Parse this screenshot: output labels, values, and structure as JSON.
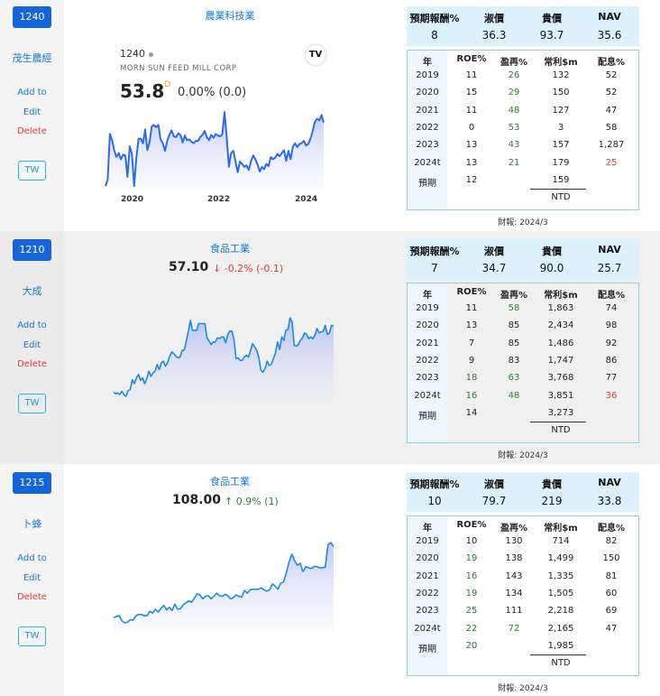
{
  "stocks": [
    {
      "code": "1240",
      "name": "茂生農經",
      "sector": "農業科技業",
      "tv": {
        "symbol": "1240",
        "company": "MORN SUN FEED MILL CORP",
        "price": "53.8",
        "flag": "D",
        "change": "0.00% (0.0)",
        "logo": "TV",
        "years": [
          "2020",
          "2022",
          "2024"
        ]
      },
      "actions": {
        "add": "Add to",
        "edit": "Edit",
        "delete": "Delete",
        "tw": "TW"
      },
      "header": {
        "labels": [
          "預期報酬%",
          "淑價",
          "貴價",
          "NAV"
        ],
        "values": [
          "8",
          "36.3",
          "93.7",
          "35.6"
        ]
      },
      "cols": [
        "年",
        "ROE%",
        "盈再%",
        "常利$m",
        "配息%"
      ],
      "rows": [
        [
          "2019",
          "11",
          "26",
          "132",
          "52"
        ],
        [
          "2020",
          "15",
          "29",
          "150",
          "52"
        ],
        [
          "2021",
          "11",
          "48",
          "127",
          "47"
        ],
        [
          "2022",
          "0",
          "53",
          "3",
          "58"
        ],
        [
          "2023",
          "13",
          "43",
          "157",
          "1,287"
        ],
        [
          "2024t",
          "13",
          "21",
          "179",
          "25"
        ],
        [
          "預期",
          "12",
          "",
          "159",
          ""
        ]
      ],
      "currency": "NTD",
      "report": "財報: 2024/3",
      "series": [
        20,
        28,
        88,
        80,
        66,
        58,
        63,
        55,
        61,
        60,
        32,
        72,
        62,
        20,
        57,
        82,
        82,
        76,
        94,
        67,
        78,
        98,
        100,
        97,
        100,
        81,
        76,
        66,
        79,
        87,
        93,
        85,
        84,
        89,
        87,
        77,
        86,
        80,
        81,
        78,
        76,
        79,
        79,
        84,
        87,
        92,
        84,
        80,
        87,
        83,
        88,
        86,
        85,
        88,
        117,
        84,
        45,
        63,
        66,
        52,
        38,
        52,
        49,
        45,
        47,
        41,
        52,
        60,
        55,
        48,
        39,
        45,
        42,
        49,
        46,
        58,
        55,
        57,
        62,
        59,
        63,
        67,
        53,
        66,
        55,
        71,
        76,
        71,
        75,
        76,
        79,
        73,
        75,
        82,
        92,
        104,
        108,
        106,
        113,
        103
      ]
    },
    {
      "code": "1210",
      "name": "大成",
      "sector": "食品工業",
      "price": "57.10",
      "arrow": "↓",
      "change": "-0.2% (-0.1)",
      "actions": {
        "add": "Add to",
        "edit": "Edit",
        "delete": "Delete",
        "tw": "TW"
      },
      "header": {
        "labels": [
          "預期報酬%",
          "淑價",
          "貴價",
          "NAV"
        ],
        "values": [
          "7",
          "34.7",
          "90.0",
          "25.7"
        ]
      },
      "cols": [
        "年",
        "ROE%",
        "盈再%",
        "常利$m",
        "配息%"
      ],
      "rows": [
        [
          "2019",
          "11",
          "58",
          "1,863",
          "74"
        ],
        [
          "2020",
          "13",
          "85",
          "2,434",
          "98"
        ],
        [
          "2021",
          "7",
          "85",
          "1,486",
          "92"
        ],
        [
          "2022",
          "9",
          "83",
          "1,747",
          "86"
        ],
        [
          "2023",
          "18",
          "63",
          "3,768",
          "77"
        ],
        [
          "2024t",
          "16",
          "48",
          "3,851",
          "36"
        ],
        [
          "預期",
          "14",
          "",
          "3,273",
          ""
        ]
      ],
      "currency": "NTD",
      "report": "財報: 2024/3",
      "series": [
        47,
        45,
        46,
        44,
        48,
        44,
        42,
        49,
        50,
        62,
        57,
        64,
        68,
        61,
        64,
        57,
        63,
        72,
        66,
        70,
        72,
        80,
        74,
        82,
        84,
        78,
        82,
        90,
        95,
        93,
        90,
        88,
        89,
        97,
        97,
        108,
        120,
        133,
        121,
        121,
        121,
        129,
        129,
        129,
        129,
        112,
        108,
        104,
        107,
        107,
        112,
        111,
        113,
        113,
        106,
        116,
        120,
        120,
        110,
        87,
        88,
        85,
        85,
        89,
        91,
        89,
        97,
        105,
        101,
        97,
        88,
        73,
        71,
        75,
        84,
        79,
        80,
        87,
        94,
        107,
        98,
        113,
        109,
        121,
        122,
        136,
        131,
        103,
        102,
        104,
        109,
        112,
        118,
        116,
        111,
        113,
        111,
        115,
        123,
        118,
        119,
        120,
        127,
        116,
        118,
        127,
        126
      ]
    },
    {
      "code": "1215",
      "name": "卜蜂",
      "sector": "食品工業",
      "price": "108.00",
      "arrow": "↑",
      "change": "0.9% (1)",
      "actions": {
        "add": "Add to",
        "edit": "Edit",
        "delete": "Delete",
        "tw": "TW"
      },
      "header": {
        "labels": [
          "預期報酬%",
          "淑價",
          "貴價",
          "NAV"
        ],
        "values": [
          "10",
          "79.7",
          "219",
          "33.8"
        ]
      },
      "cols": [
        "年",
        "ROE%",
        "盈再%",
        "常利$m",
        "配息%"
      ],
      "rows": [
        [
          "2019",
          "10",
          "130",
          "714",
          "82"
        ],
        [
          "2020",
          "19",
          "138",
          "1,499",
          "150"
        ],
        [
          "2021",
          "16",
          "143",
          "1,335",
          "81"
        ],
        [
          "2022",
          "19",
          "134",
          "1,505",
          "60"
        ],
        [
          "2023",
          "25",
          "111",
          "2,218",
          "69"
        ],
        [
          "2024t",
          "22",
          "72",
          "2,165",
          "47"
        ],
        [
          "預期",
          "20",
          "",
          "1,985",
          ""
        ]
      ],
      "currency": "NTD",
      "report": "財報: 2024/3",
      "series": [
        60,
        62,
        63,
        55,
        52,
        53,
        57,
        56,
        63,
        65,
        65,
        63,
        63,
        70,
        67,
        73,
        69,
        74,
        79,
        72,
        76,
        71,
        81,
        73,
        74,
        80,
        83,
        86,
        84,
        90,
        97,
        95,
        89,
        93,
        94,
        89,
        93,
        98,
        94,
        93,
        96,
        94,
        89,
        91,
        95,
        93,
        92,
        102,
        98,
        103,
        104,
        104,
        104,
        106,
        103,
        101,
        103,
        112,
        109,
        104,
        113,
        115,
        129,
        146,
        158,
        148,
        141,
        144,
        131,
        139,
        137,
        136,
        139,
        139,
        137,
        137,
        138,
        173,
        176,
        170
      ]
    }
  ]
}
